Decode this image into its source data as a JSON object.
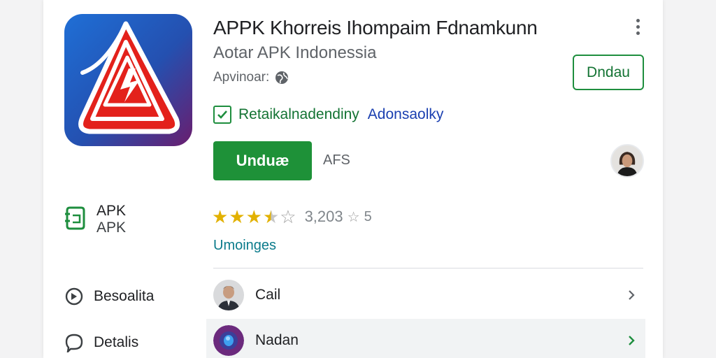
{
  "app": {
    "title": "APPK Khorreis Ihompaim Fdnamkunn",
    "developer": "Aotar APK Indonessia",
    "meta": "Apvinoar:",
    "verified_text": "Retaikalnadendiny",
    "verified_link": "Adonsaolky"
  },
  "buttons": {
    "outline_label": "Dndau",
    "install_label": "Unduæ",
    "size_label": "AFS"
  },
  "sidebar": {
    "apk_title": "APK",
    "apk_subtitle": "APK",
    "related_label": "Besoalita",
    "details_label": "Detalis"
  },
  "rating": {
    "count": "3,203",
    "five": "5",
    "stars_value": 3.5,
    "reviews_link": "Umoinges"
  },
  "list": {
    "items": [
      {
        "label": "Cail"
      },
      {
        "label": "Nadan"
      }
    ]
  },
  "colors": {
    "primary_green": "#1e9138",
    "star_gold": "#e2b100",
    "link_blue": "#1a3fb0",
    "teal_link": "#0b7b8b"
  },
  "icons": [
    "app-logo-icon",
    "more-vert-icon",
    "globe-icon",
    "check-icon",
    "apk-file-icon",
    "history-icon",
    "comment-icon",
    "chevron-right-icon"
  ]
}
